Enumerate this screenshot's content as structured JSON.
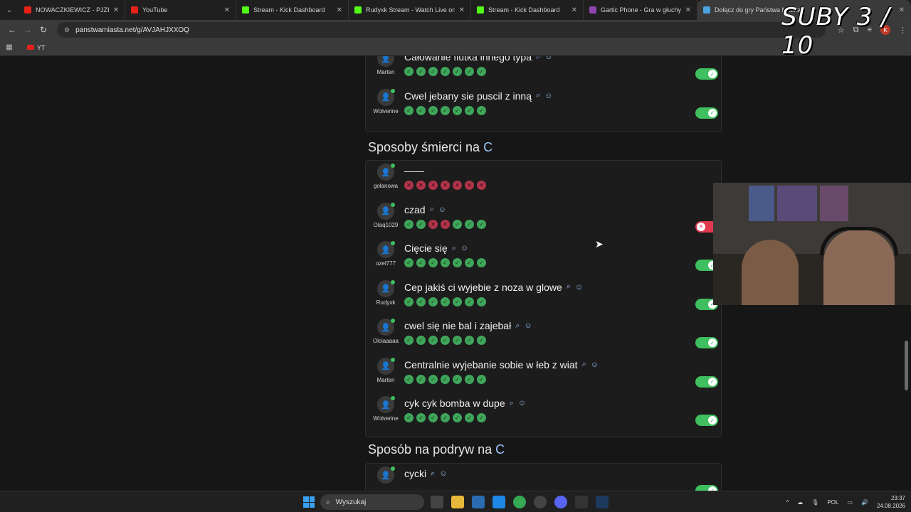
{
  "browser": {
    "tabs": [
      {
        "title": "NOWACZKIEWICZ - PJZK ft",
        "fav": "#e62117",
        "width": 150
      },
      {
        "title": "YouTube",
        "fav": "#e62117",
        "width": 156
      },
      {
        "title": "Stream - Kick Dashboard",
        "fav": "#53fc18",
        "width": 158
      },
      {
        "title": "Rudyxk Stream - Watch Live on",
        "fav": "#53fc18",
        "width": 172
      },
      {
        "title": "Stream - Kick Dashboard",
        "fav": "#53fc18",
        "width": 158
      },
      {
        "title": "Gartic Phone - Gra w głuchy tel",
        "fav": "#8e44ad",
        "width": 160
      },
      {
        "title": "Dołącz do gry Państwa Miasta",
        "fav": "#4aa3df",
        "width": 300
      }
    ],
    "url": "panstwamiasta.net/g/AVJAHJXXOQ",
    "bookmark": "YT",
    "profile_initial": "K"
  },
  "overlay_text": "SUBY 3 / 10",
  "sections": [
    {
      "title_prefix": "",
      "letter": "",
      "rows": [
        {
          "user": "Marten",
          "answer": "Całowanie fiutka innego typa",
          "votes": [
            "ok",
            "ok",
            "ok",
            "ok",
            "ok",
            "ok",
            "ok"
          ],
          "toggle": "on"
        },
        {
          "user": "Wolverine",
          "answer": "Cwel jebany sie puscil z inną",
          "votes": [
            "ok",
            "ok",
            "ok",
            "ok",
            "ok",
            "ok",
            "ok"
          ],
          "toggle": "on"
        }
      ]
    },
    {
      "title_prefix": "Sposoby śmierci na ",
      "letter": "C",
      "rows": [
        {
          "user": "golanowa",
          "answer": "——",
          "votes": [
            "no",
            "no",
            "no",
            "no",
            "no",
            "no",
            "no"
          ],
          "toggle": "none"
        },
        {
          "user": "Olaq1029",
          "answer": "czad",
          "votes": [
            "ok",
            "ok",
            "no",
            "no",
            "ok",
            "ok",
            "ok"
          ],
          "toggle": "off"
        },
        {
          "user": "ozel777",
          "answer": "Cięcie się",
          "votes": [
            "ok",
            "ok",
            "ok",
            "ok",
            "ok",
            "ok",
            "ok"
          ],
          "toggle": "on"
        },
        {
          "user": "Rudyxk",
          "answer": "Cep jakiś ci wyjebie z noza w glowe",
          "votes": [
            "ok",
            "ok",
            "ok",
            "ok",
            "ok",
            "ok",
            "ok"
          ],
          "toggle": "on"
        },
        {
          "user": "Olciaaaaa",
          "answer": "cwel się nie bal i zajebał",
          "votes": [
            "ok",
            "ok",
            "ok",
            "ok",
            "ok",
            "ok",
            "ok"
          ],
          "toggle": "on"
        },
        {
          "user": "Marten",
          "answer": "Centralnie wyjebanie sobie w łeb z wiat",
          "votes": [
            "ok",
            "ok",
            "ok",
            "ok",
            "ok",
            "ok",
            "ok"
          ],
          "toggle": "on"
        },
        {
          "user": "Wolverine",
          "answer": "cyk cyk bomba w dupe",
          "votes": [
            "ok",
            "ok",
            "ok",
            "ok",
            "ok",
            "ok",
            "ok"
          ],
          "toggle": "on"
        }
      ]
    },
    {
      "title_prefix": "Sposób na podryw na ",
      "letter": "C",
      "rows": [
        {
          "user": "",
          "answer": "cycki",
          "votes": [],
          "toggle": "on"
        }
      ]
    }
  ],
  "taskbar": {
    "search_placeholder": "Wyszukaj",
    "lang": "POL",
    "time": "23:37",
    "date": "24.08.2026"
  }
}
